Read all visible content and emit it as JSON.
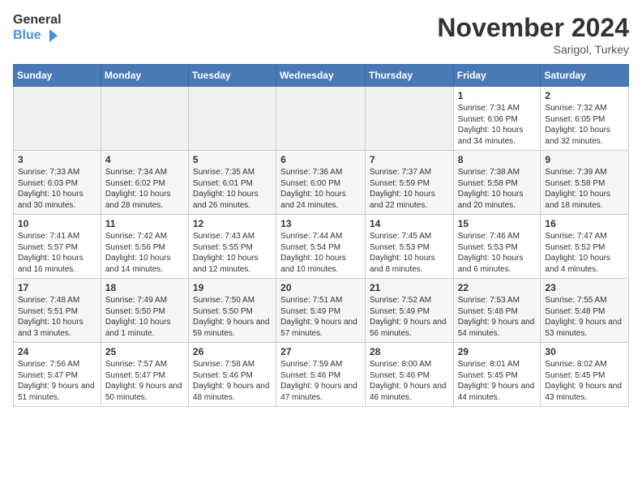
{
  "header": {
    "logo_general": "General",
    "logo_blue": "Blue",
    "month_title": "November 2024",
    "location": "Sarigol, Turkey"
  },
  "days_of_week": [
    "Sunday",
    "Monday",
    "Tuesday",
    "Wednesday",
    "Thursday",
    "Friday",
    "Saturday"
  ],
  "weeks": [
    [
      {
        "day": "",
        "info": ""
      },
      {
        "day": "",
        "info": ""
      },
      {
        "day": "",
        "info": ""
      },
      {
        "day": "",
        "info": ""
      },
      {
        "day": "",
        "info": ""
      },
      {
        "day": "1",
        "info": "Sunrise: 7:31 AM\nSunset: 6:06 PM\nDaylight: 10 hours and 34 minutes."
      },
      {
        "day": "2",
        "info": "Sunrise: 7:32 AM\nSunset: 6:05 PM\nDaylight: 10 hours and 32 minutes."
      }
    ],
    [
      {
        "day": "3",
        "info": "Sunrise: 7:33 AM\nSunset: 6:03 PM\nDaylight: 10 hours and 30 minutes."
      },
      {
        "day": "4",
        "info": "Sunrise: 7:34 AM\nSunset: 6:02 PM\nDaylight: 10 hours and 28 minutes."
      },
      {
        "day": "5",
        "info": "Sunrise: 7:35 AM\nSunset: 6:01 PM\nDaylight: 10 hours and 26 minutes."
      },
      {
        "day": "6",
        "info": "Sunrise: 7:36 AM\nSunset: 6:00 PM\nDaylight: 10 hours and 24 minutes."
      },
      {
        "day": "7",
        "info": "Sunrise: 7:37 AM\nSunset: 5:59 PM\nDaylight: 10 hours and 22 minutes."
      },
      {
        "day": "8",
        "info": "Sunrise: 7:38 AM\nSunset: 5:58 PM\nDaylight: 10 hours and 20 minutes."
      },
      {
        "day": "9",
        "info": "Sunrise: 7:39 AM\nSunset: 5:58 PM\nDaylight: 10 hours and 18 minutes."
      }
    ],
    [
      {
        "day": "10",
        "info": "Sunrise: 7:41 AM\nSunset: 5:57 PM\nDaylight: 10 hours and 16 minutes."
      },
      {
        "day": "11",
        "info": "Sunrise: 7:42 AM\nSunset: 5:56 PM\nDaylight: 10 hours and 14 minutes."
      },
      {
        "day": "12",
        "info": "Sunrise: 7:43 AM\nSunset: 5:55 PM\nDaylight: 10 hours and 12 minutes."
      },
      {
        "day": "13",
        "info": "Sunrise: 7:44 AM\nSunset: 5:54 PM\nDaylight: 10 hours and 10 minutes."
      },
      {
        "day": "14",
        "info": "Sunrise: 7:45 AM\nSunset: 5:53 PM\nDaylight: 10 hours and 8 minutes."
      },
      {
        "day": "15",
        "info": "Sunrise: 7:46 AM\nSunset: 5:53 PM\nDaylight: 10 hours and 6 minutes."
      },
      {
        "day": "16",
        "info": "Sunrise: 7:47 AM\nSunset: 5:52 PM\nDaylight: 10 hours and 4 minutes."
      }
    ],
    [
      {
        "day": "17",
        "info": "Sunrise: 7:48 AM\nSunset: 5:51 PM\nDaylight: 10 hours and 3 minutes."
      },
      {
        "day": "18",
        "info": "Sunrise: 7:49 AM\nSunset: 5:50 PM\nDaylight: 10 hours and 1 minute."
      },
      {
        "day": "19",
        "info": "Sunrise: 7:50 AM\nSunset: 5:50 PM\nDaylight: 9 hours and 59 minutes."
      },
      {
        "day": "20",
        "info": "Sunrise: 7:51 AM\nSunset: 5:49 PM\nDaylight: 9 hours and 57 minutes."
      },
      {
        "day": "21",
        "info": "Sunrise: 7:52 AM\nSunset: 5:49 PM\nDaylight: 9 hours and 56 minutes."
      },
      {
        "day": "22",
        "info": "Sunrise: 7:53 AM\nSunset: 5:48 PM\nDaylight: 9 hours and 54 minutes."
      },
      {
        "day": "23",
        "info": "Sunrise: 7:55 AM\nSunset: 5:48 PM\nDaylight: 9 hours and 53 minutes."
      }
    ],
    [
      {
        "day": "24",
        "info": "Sunrise: 7:56 AM\nSunset: 5:47 PM\nDaylight: 9 hours and 51 minutes."
      },
      {
        "day": "25",
        "info": "Sunrise: 7:57 AM\nSunset: 5:47 PM\nDaylight: 9 hours and 50 minutes."
      },
      {
        "day": "26",
        "info": "Sunrise: 7:58 AM\nSunset: 5:46 PM\nDaylight: 9 hours and 48 minutes."
      },
      {
        "day": "27",
        "info": "Sunrise: 7:59 AM\nSunset: 5:46 PM\nDaylight: 9 hours and 47 minutes."
      },
      {
        "day": "28",
        "info": "Sunrise: 8:00 AM\nSunset: 5:46 PM\nDaylight: 9 hours and 46 minutes."
      },
      {
        "day": "29",
        "info": "Sunrise: 8:01 AM\nSunset: 5:45 PM\nDaylight: 9 hours and 44 minutes."
      },
      {
        "day": "30",
        "info": "Sunrise: 8:02 AM\nSunset: 5:45 PM\nDaylight: 9 hours and 43 minutes."
      }
    ]
  ]
}
